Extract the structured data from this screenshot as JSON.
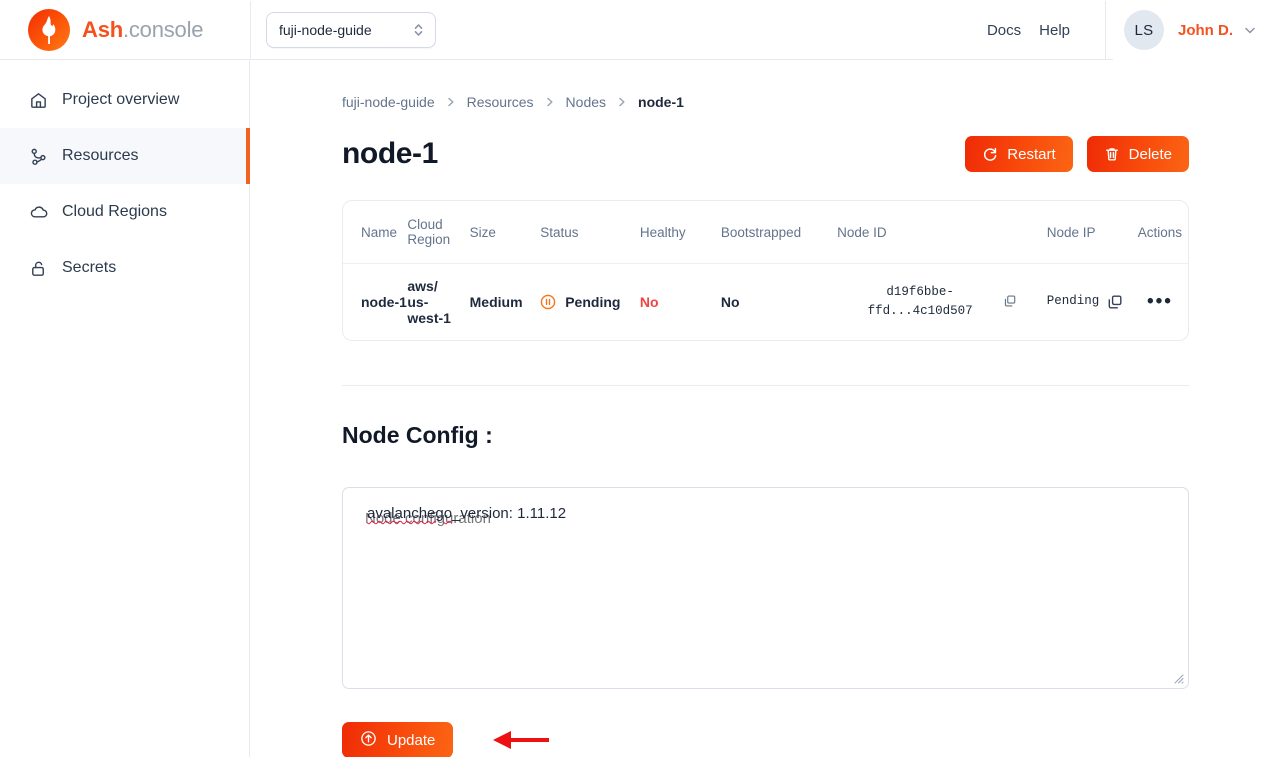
{
  "brand": {
    "name_bold": "Ash",
    "name_light": ".console",
    "logo_icon": "flame-logo-icon"
  },
  "header": {
    "project_selector": {
      "value": "fuji-node-guide",
      "icon": "chevron-up-down-icon"
    },
    "links": [
      {
        "label": "Docs",
        "name": "docs-link"
      },
      {
        "label": "Help",
        "name": "help-link"
      }
    ],
    "user": {
      "initials": "LS",
      "name": "John D.",
      "caret_icon": "chevron-down-icon"
    }
  },
  "sidebar": {
    "items": [
      {
        "label": "Project overview",
        "icon": "home-icon",
        "active": false
      },
      {
        "label": "Resources",
        "icon": "network-share-icon",
        "active": true
      },
      {
        "label": "Cloud Regions",
        "icon": "cloud-icon",
        "active": false
      },
      {
        "label": "Secrets",
        "icon": "unlock-icon",
        "active": false
      }
    ]
  },
  "breadcrumb": {
    "items": [
      "fuji-node-guide",
      "Resources",
      "Nodes"
    ],
    "current": "node-1",
    "separator_icon": "chevron-right-icon"
  },
  "page": {
    "title": "node-1",
    "restart_button": {
      "label": "Restart",
      "icon": "refresh-icon"
    },
    "delete_button": {
      "label": "Delete",
      "icon": "trash-icon"
    }
  },
  "table": {
    "headers": {
      "name": "Name",
      "cloud_region_l1": "Cloud",
      "cloud_region_l2": "Region",
      "size": "Size",
      "status": "Status",
      "healthy": "Healthy",
      "bootstrapped": "Bootstrapped",
      "node_id": "Node ID",
      "node_ip": "Node IP",
      "actions": "Actions"
    },
    "row": {
      "name": "node-1",
      "cloud_region_l1": "aws/",
      "cloud_region_l2": "us-",
      "cloud_region_l3": "west-1",
      "size": "Medium",
      "status": "Pending",
      "status_icon": "pause-circle-icon",
      "healthy": "No",
      "bootstrapped": "No",
      "node_id_l1": "d19f6bbe-",
      "node_id_l2": "ffd...4c10d507",
      "node_id_copy_icon": "copy-icon",
      "node_ip": "Pending",
      "node_ip_copy_icon": "copy-icon",
      "actions_icon": "ellipsis-icon"
    }
  },
  "config": {
    "section_title": "Node Config :",
    "value_key": "avalanchego",
    "value_rest": "_version: 1.11.12",
    "placeholder": "Node configuration"
  },
  "update": {
    "label": "Update",
    "icon": "arrow-up-circle-icon",
    "annotation_icon": "left-arrow-annotation"
  },
  "colors": {
    "accent": "#f26322",
    "brand_orange": "#f4511e",
    "danger": "#ef4444",
    "status_pending": "#f97316",
    "text": "#1e293b",
    "muted": "#64748b",
    "border": "#e8ecf2",
    "active_bg": "#f6f8fb"
  }
}
